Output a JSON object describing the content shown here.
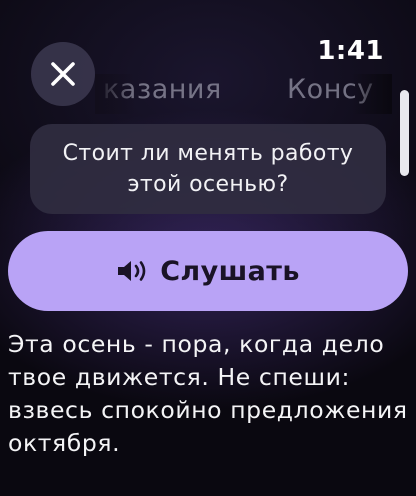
{
  "status_bar": {
    "time": "1:41"
  },
  "close_button": {
    "icon": "close-icon"
  },
  "tabs": [
    {
      "label": "казания"
    },
    {
      "label": "Консу"
    }
  ],
  "question_card": {
    "text": "Стоит ли менять работу этой осенью?"
  },
  "listen_button": {
    "icon": "speaker-icon",
    "label": "Слушать"
  },
  "answer": {
    "text": "Эта осень - пора, когда дело твое движется. Не спеши: взвесь спокойно предложения октября."
  },
  "colors": {
    "accent": "#b9a3f6",
    "card": "#302c40",
    "background": "#0a0810"
  }
}
